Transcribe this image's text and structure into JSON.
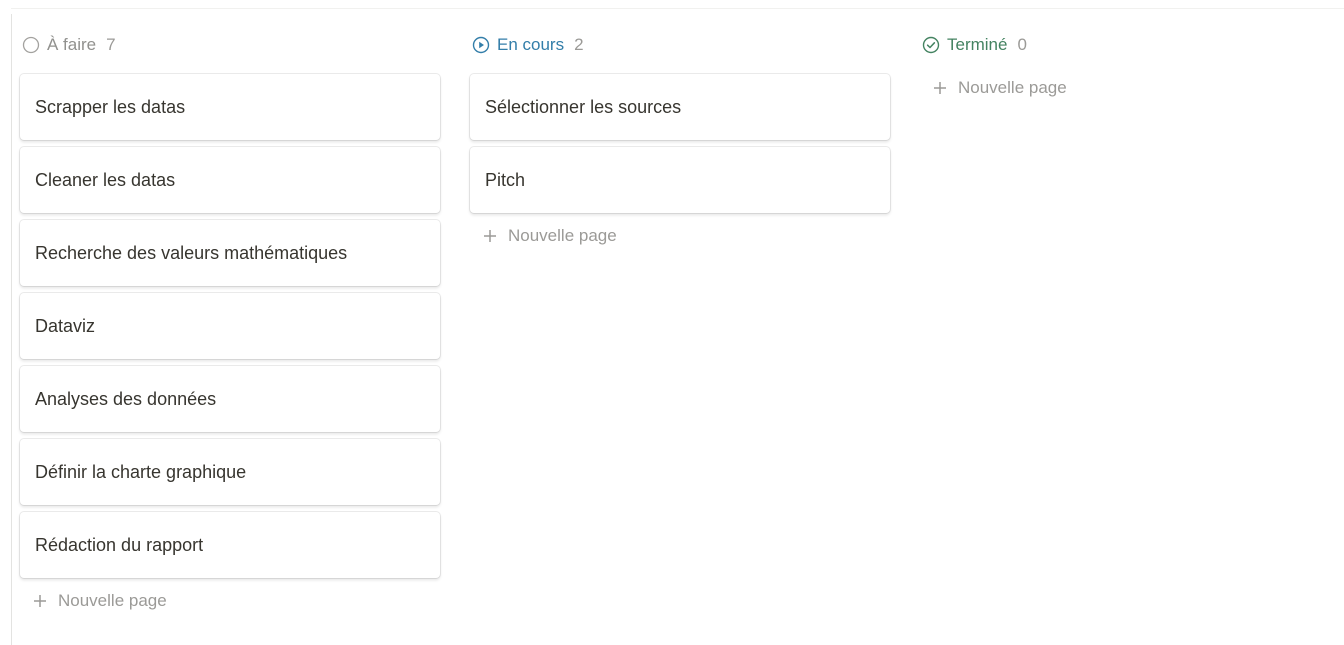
{
  "board": {
    "columns": [
      {
        "title": "À faire",
        "count": "7",
        "icon": "circle-outline-icon",
        "color": "#91918e",
        "cards": [
          "Scrapper les datas",
          "Cleaner les datas",
          "Recherche des valeurs mathématiques",
          "Dataviz",
          "Analyses des données",
          "Définir la charte graphique",
          "Rédaction du rapport"
        ],
        "new_page_label": "Nouvelle page"
      },
      {
        "title": "En cours",
        "count": "2",
        "icon": "play-circle-icon",
        "color": "#337ea9",
        "cards": [
          "Sélectionner les sources",
          "Pitch"
        ],
        "new_page_label": "Nouvelle page"
      },
      {
        "title": "Terminé",
        "count": "0",
        "icon": "check-circle-icon",
        "color": "#448361",
        "cards": [],
        "new_page_label": "Nouvelle page"
      }
    ]
  }
}
